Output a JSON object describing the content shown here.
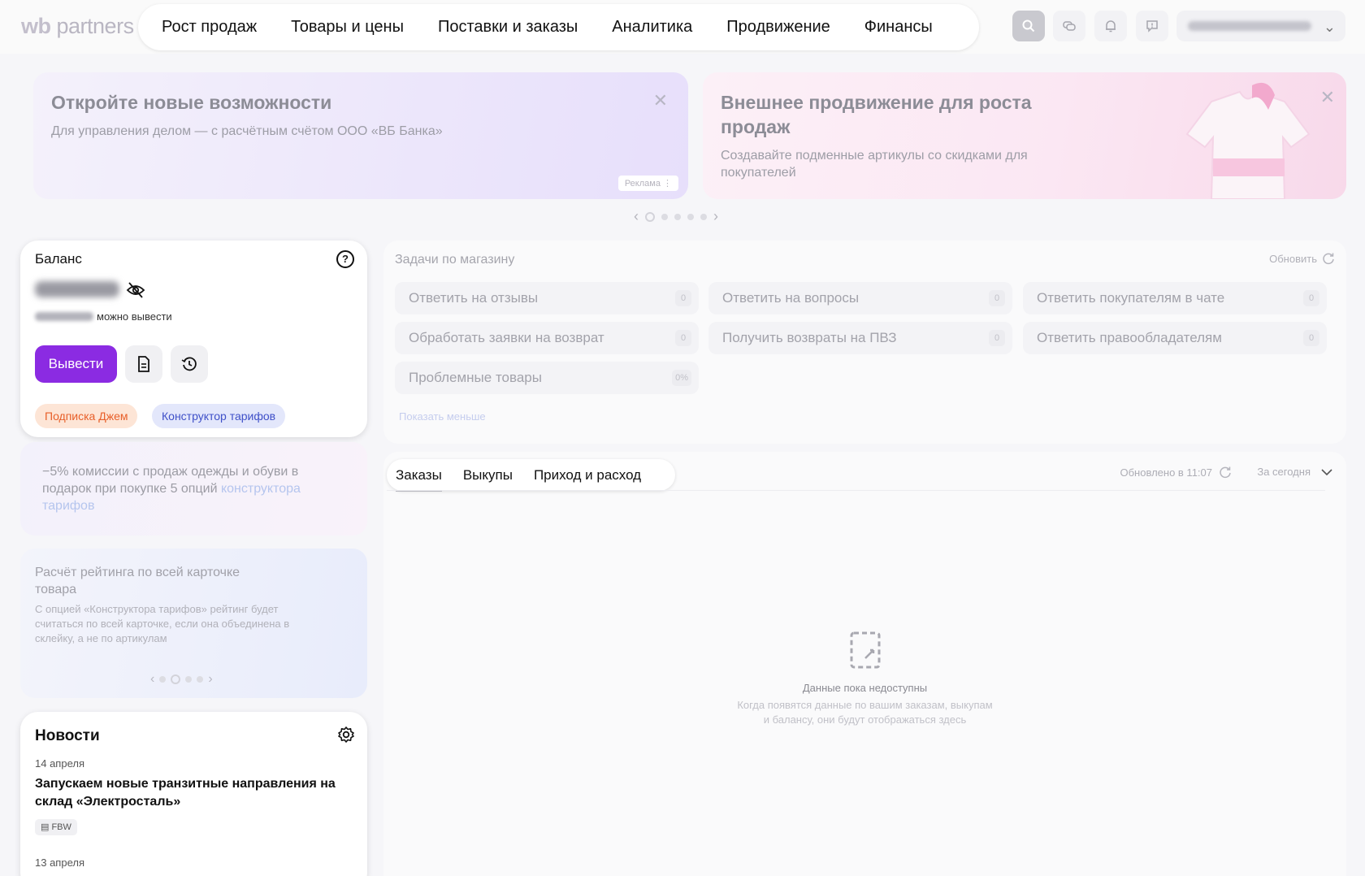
{
  "header": {
    "logo_prefix": "wb",
    "logo_suffix": "partners",
    "nav": [
      "Рост продаж",
      "Товары и цены",
      "Поставки и заказы",
      "Аналитика",
      "Продвижение",
      "Финансы"
    ],
    "icons": [
      "search-icon",
      "chat-icon",
      "bell-icon",
      "feedback-icon"
    ],
    "user_name": "ИП Сурадиле М. И."
  },
  "banners": [
    {
      "title": "Откройте новые возможности",
      "text": "Для управления делом — с расчётным счётом ООО «ВБ Банка»",
      "ad_label": "Реклама"
    },
    {
      "title_line1": "Внешнее продвижение для роста",
      "title_line2": "продаж",
      "text_line1": "Создавайте подменные артикулы со скидками для",
      "text_line2": "покупателей"
    }
  ],
  "balance": {
    "title": "Баланс",
    "amount": "358,58 ₽",
    "withdrawable": "2 303,87 ₽",
    "withdrawable_label": "можно вывести",
    "withdraw_button": "Вывести",
    "tags": [
      "Подписка Джем",
      "Конструктор тарифов"
    ]
  },
  "promo_commission": {
    "text": "−5% комиссии с продаж одежды и обуви в подарок при покупке 5 опций ",
    "link": "конструктора тарифов"
  },
  "promo_rating": {
    "title": "Расчёт рейтинга по всей карточке товара",
    "text": "С опцией «Конструктора тарифов» рейтинг будет считаться по всей карточке, если она объединена в склейку, а не по артикулам"
  },
  "news": {
    "title": "Новости",
    "items": [
      {
        "date": "14 апреля",
        "headline": "Запускаем новые транзитные направления на склад «Электросталь»",
        "badge": "FBW"
      },
      {
        "date": "13 апреля"
      }
    ]
  },
  "tasks": {
    "title": "Задачи по магазину",
    "refresh": "Обновить",
    "items": [
      {
        "label": "Ответить на отзывы",
        "count": "0"
      },
      {
        "label": "Ответить на вопросы",
        "count": "0"
      },
      {
        "label": "Ответить покупателям в чате",
        "count": "0"
      },
      {
        "label": "Обработать заявки на возврат",
        "count": "0"
      },
      {
        "label": "Получить возвраты на ПВЗ",
        "count": "0"
      },
      {
        "label": "Ответить правообладателям",
        "count": "0"
      },
      {
        "label": "Проблемные товары",
        "count": "0%"
      }
    ],
    "show_less": "Показать меньше"
  },
  "orders": {
    "tabs": [
      "Заказы",
      "Выкупы",
      "Приход и расход"
    ],
    "updated": "Обновлено в 11:07",
    "period": "За сегодня",
    "empty_title": "Данные пока недоступны",
    "empty_line1": "Когда появятся данные по вашим заказам, выкупам",
    "empty_line2": "и балансу, они будут отображаться здесь"
  },
  "colors": {
    "accent": "#8b2be2",
    "orange_tag": "#e8602a",
    "blue_tag": "#3f50c8"
  }
}
